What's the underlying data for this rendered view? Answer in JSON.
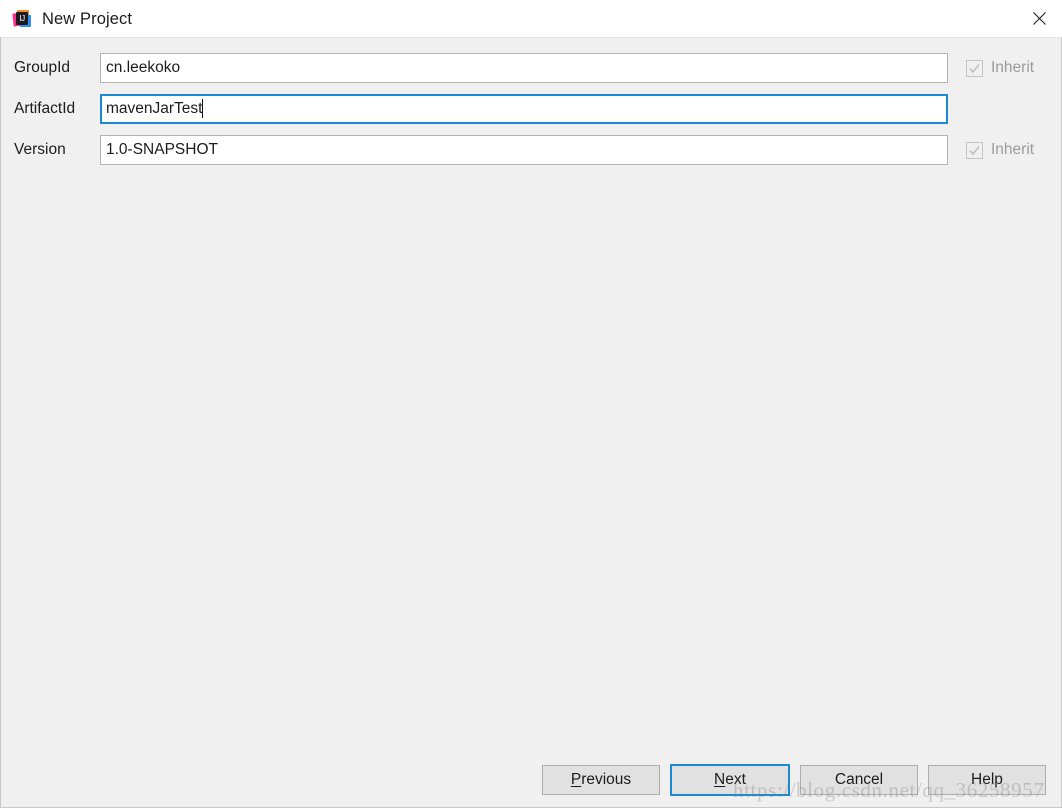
{
  "window": {
    "title": "New Project",
    "app_icon": "intellij-idea-icon",
    "icon_text": "IJ",
    "close_icon": "close-icon",
    "background_color": "#f0f0f0",
    "titlebar_color": "#ffffff"
  },
  "form": {
    "fields": [
      {
        "label": "GroupId",
        "value": "cn.leekoko",
        "placeholder": "",
        "focused": false,
        "inherit": {
          "label": "Inherit",
          "checked": true,
          "enabled": false
        }
      },
      {
        "label": "ArtifactId",
        "value": "mavenJarTest",
        "placeholder": "",
        "focused": true,
        "inherit": null
      },
      {
        "label": "Version",
        "value": "1.0-SNAPSHOT",
        "placeholder": "",
        "focused": false,
        "inherit": {
          "label": "Inherit",
          "checked": true,
          "enabled": false
        }
      }
    ]
  },
  "buttons": [
    {
      "name": "previous",
      "label_before": "",
      "mnemonic": "P",
      "label_after": "revious",
      "default": false
    },
    {
      "name": "next",
      "label_before": "",
      "mnemonic": "N",
      "label_after": "ext",
      "default": true
    },
    {
      "name": "cancel",
      "label_before": "Cancel",
      "mnemonic": "",
      "label_after": "",
      "default": false
    },
    {
      "name": "help",
      "label_before": "Help",
      "mnemonic": "",
      "label_after": "",
      "default": false
    }
  ],
  "watermark": {
    "text": "https://blog.csdn.net/qq_36258957"
  },
  "colors": {
    "focus_blue": "#1b8ad4",
    "text": "#1c1c1c",
    "disabled_text": "#9b9b9b",
    "button_face": "#e1e1e1",
    "dialog_bg": "#f0f0f0"
  }
}
